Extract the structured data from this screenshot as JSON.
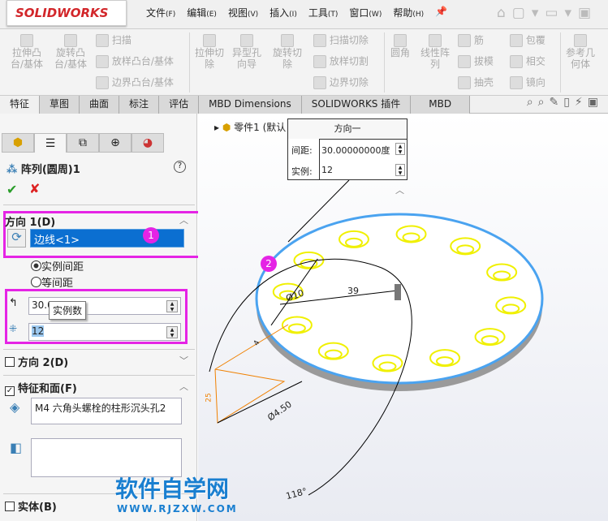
{
  "app": {
    "logo": "SOLIDWORKS"
  },
  "menu": [
    {
      "label": "文件",
      "key": "(F)"
    },
    {
      "label": "编辑",
      "key": "(E)"
    },
    {
      "label": "视图",
      "key": "(V)"
    },
    {
      "label": "插入",
      "key": "(I)"
    },
    {
      "label": "工具",
      "key": "(T)"
    },
    {
      "label": "窗口",
      "key": "(W)"
    },
    {
      "label": "帮助",
      "key": "(H)"
    }
  ],
  "ribbon": {
    "extrude_boss": "拉伸凸台/基体",
    "revolve_boss": "旋转凸台/基体",
    "sweep": "扫描",
    "loft": "放样凸台/基体",
    "boundary": "边界凸台/基体",
    "extrude_cut": "拉伸切除",
    "hole_wizard": "异型孔向导",
    "revolve_cut": "旋转切除",
    "sweep_cut": "扫描切除",
    "loft_cut": "放样切割",
    "boundary_cut": "边界切除",
    "fillet": "圆角",
    "linear_pattern": "线性阵列",
    "rib": "筋",
    "draft": "拔模",
    "shell": "抽壳",
    "wrap": "包覆",
    "intersect": "相交",
    "mirror": "镜向",
    "ref_geometry": "参考几何体"
  },
  "tabs": [
    "特征",
    "草图",
    "曲面",
    "标注",
    "评估",
    "MBD Dimensions",
    "SOLIDWORKS 插件",
    "MBD"
  ],
  "panel": {
    "title": "阵列(圆周)1",
    "dir1": {
      "header": "方向 1(D)",
      "edge": "边线<1>",
      "opt1": "实例间距",
      "opt2": "等间距",
      "angle": "30.0",
      "tooltip": "实例数",
      "count": "12"
    },
    "dir2": "方向 2(D)",
    "features": {
      "header": "特征和面(F)",
      "item": "M4 六角头螺栓的柱形沉头孔2"
    },
    "bodies": "实体(B)"
  },
  "tree": {
    "part": "零件1 (默认"
  },
  "popup": {
    "title": "方向一",
    "spacing_label": "间距:",
    "spacing": "30.00000000度",
    "count_label": "实例:",
    "count": "12"
  },
  "dims": {
    "d10": "Ø10",
    "d39": "39",
    "d450": "Ø4.50",
    "a118": "118°",
    "d25": "25",
    "d4": "4"
  },
  "badges": [
    "1",
    "2"
  ],
  "watermark": {
    "title": "软件自学网",
    "url": "WWW.RJZXW.COM"
  }
}
